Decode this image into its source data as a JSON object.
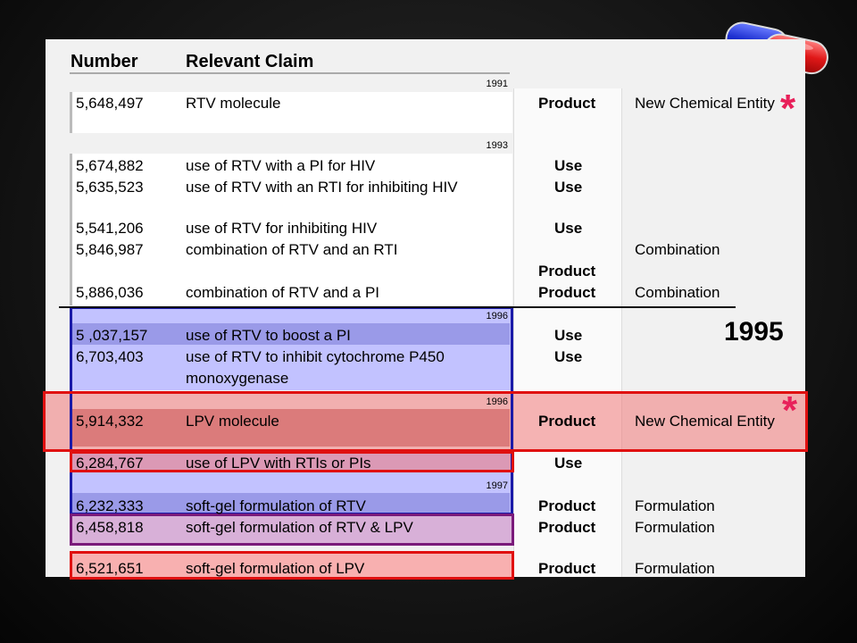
{
  "header": {
    "number": "Number",
    "claim": "Relevant Claim"
  },
  "years": {
    "y1991": "1991",
    "y1993": "1993",
    "y1996a": "1996",
    "y1996b": "1996",
    "y1997": "1997"
  },
  "big_year": "1995",
  "asterisk": "*",
  "rows": [
    {
      "number": "5,648,497",
      "claim": "RTV molecule",
      "kind": "Product",
      "type": "New Chemical Entity"
    },
    {
      "number": "5,674,882",
      "claim": "use of RTV with a PI for HIV",
      "kind": "Use",
      "type": ""
    },
    {
      "number": "5,635,523",
      "claim": "use of RTV with an RTI for inhibiting HIV",
      "kind": "Use",
      "type": ""
    },
    {
      "number": "5,541,206",
      "claim": "use of RTV for inhibiting HIV",
      "kind": "Use",
      "type": ""
    },
    {
      "number": "5,846,987",
      "claim": "combination of RTV and an RTI",
      "kind": "Product",
      "type": "Combination"
    },
    {
      "number": "5,886,036",
      "claim": "combination of RTV and a PI",
      "kind": "Product",
      "type": "Combination"
    },
    {
      "number": "5 ,037,157",
      "claim": "use of RTV to boost a PI",
      "kind": "Use",
      "type": ""
    },
    {
      "number": "6,703,403",
      "claim": "use of RTV to inhibit cytochrome P450",
      "claim2": "monoxygenase",
      "kind": "Use",
      "type": ""
    },
    {
      "number": "5,914,332",
      "claim": "LPV molecule",
      "kind": "Product",
      "type": "New Chemical Entity"
    },
    {
      "number": "6,284,767",
      "claim": "use of LPV with RTIs or PIs",
      "kind": "Use",
      "type": ""
    },
    {
      "number": "6,232,333",
      "claim": "soft-gel formulation of RTV",
      "kind": "Product",
      "type": "Formulation"
    },
    {
      "number": "6,458,818",
      "claim": "soft-gel formulation of RTV & LPV",
      "kind": "Product",
      "type": "Formulation"
    },
    {
      "number": "6,521,651",
      "claim": "soft-gel formulation of LPV",
      "kind": "Product",
      "type": "Formulation"
    }
  ],
  "colors": {
    "blue_box": "#1a1aa8",
    "red_box": "#e01010",
    "purple_box": "#7a1a7a",
    "asterisk": "#e8205a"
  }
}
